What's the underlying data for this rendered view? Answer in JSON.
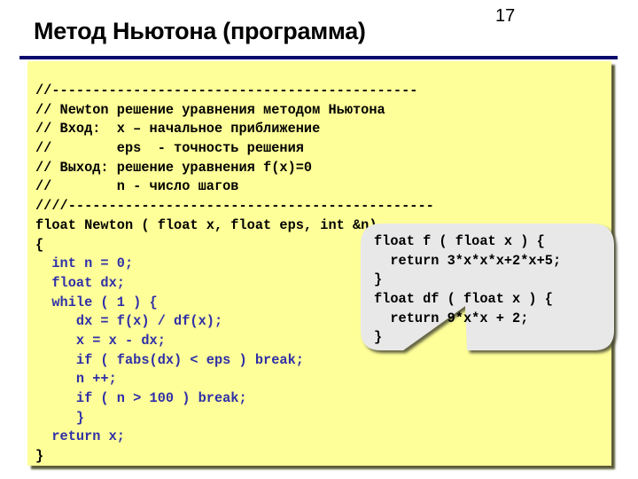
{
  "slide": {
    "number": "17",
    "title": "Метод Ньютона (программа)"
  },
  "colors": {
    "rule": "#0b0b6e",
    "code_background": "#ffff99",
    "callout_background": "#e8e8e8",
    "keyword_blue": "#2f2fa8"
  },
  "code": {
    "lines": [
      {
        "text": "//---------------------------------------------",
        "style": "black"
      },
      {
        "text": "// Newton решение уравнения методом Ньютона",
        "style": "black"
      },
      {
        "text": "// Вход:  x – начальное приближение",
        "style": "black"
      },
      {
        "text": "//        eps  - точность решения",
        "style": "black"
      },
      {
        "text": "// Выход: решение уравнения f(x)=0",
        "style": "black"
      },
      {
        "text": "//        n - число шагов",
        "style": "black"
      },
      {
        "text": "////---------------------------------------------",
        "style": "black"
      },
      {
        "text": "float Newton ( float x, float eps, int &n)",
        "style": "black"
      },
      {
        "text": "{",
        "style": "black"
      },
      {
        "text": "  int n = 0;",
        "style": "blue"
      },
      {
        "text": "  float dx;",
        "style": "blue"
      },
      {
        "text": "  while ( 1 ) {",
        "style": "blue"
      },
      {
        "text": "     dx = f(x) / df(x);",
        "style": "blue"
      },
      {
        "text": "     x = x - dx;",
        "style": "blue"
      },
      {
        "text": "     if ( fabs(dx) < eps ) break;",
        "style": "blue"
      },
      {
        "text": "     n ++;",
        "style": "blue"
      },
      {
        "text": "     if ( n > 100 ) break;",
        "style": "blue"
      },
      {
        "text": "     }",
        "style": "blue"
      },
      {
        "text": "  return x;",
        "style": "blue"
      },
      {
        "text": "}",
        "style": "black"
      }
    ]
  },
  "callout": {
    "lines": [
      "float f ( float x ) {",
      "  return 3*x*x*x+2*x+5;",
      "}",
      "float df ( float x ) {",
      "  return 9*x*x + 2;",
      "}"
    ]
  }
}
